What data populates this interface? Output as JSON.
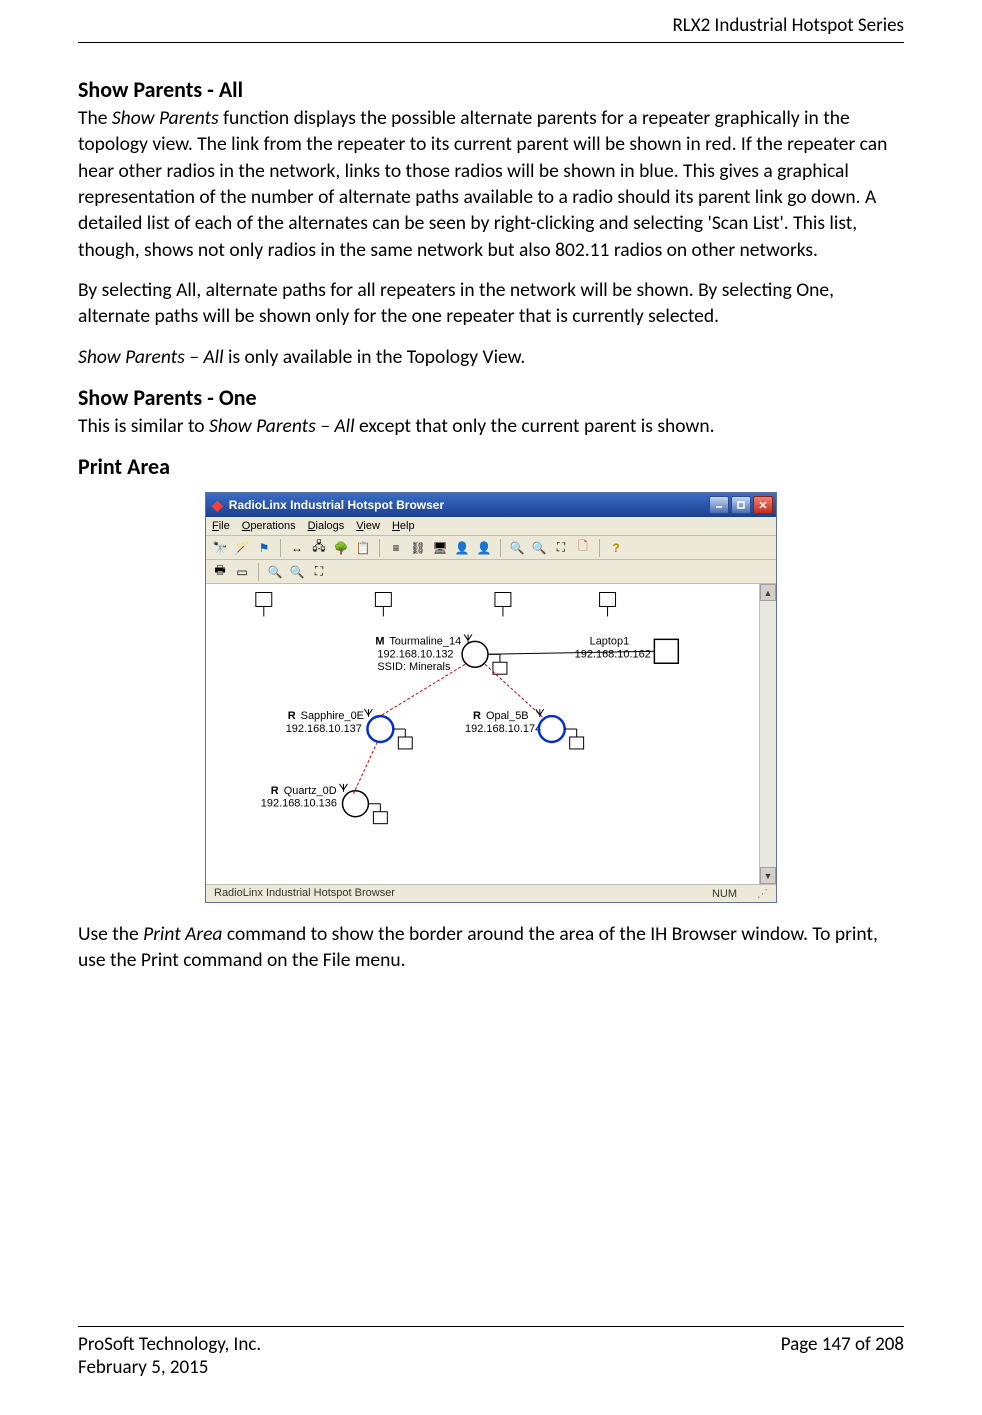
{
  "header": {
    "product": "RLX2 Industrial Hotspot Series"
  },
  "sections": {
    "showParentsAll": {
      "title": "Show Parents - All",
      "p1_a": "The ",
      "p1_b": "Show Parents",
      "p1_c": " function displays the possible alternate parents for a repeater graphically in the topology view. The link from the repeater to its current parent will be shown in red. If the repeater can hear other radios in the network, links to those radios will be shown in blue. This gives a graphical representation of the number of alternate paths available to a radio should its parent link go down. A detailed list of each of the alternates can be seen by right-clicking and selecting 'Scan List'. This list, though, shows not only radios in the same network but also 802.11 radios on other networks.",
      "p2": "By selecting All, alternate paths for all repeaters in the network will be shown. By selecting One, alternate paths will be shown only for the one repeater that is currently selected.",
      "p3_a": "Show Parents – All",
      "p3_b": " is only available in the Topology View."
    },
    "showParentsOne": {
      "title": "Show Parents - One",
      "p1_a": "This is similar to ",
      "p1_b": "Show Parents – All",
      "p1_c": " except that only the current parent is shown."
    },
    "printArea": {
      "title": "Print Area",
      "p1_a": "Use the ",
      "p1_b": "Print Area",
      "p1_c": " command to show the border around the area of the IH Browser window. To print, use the Print command on the File menu."
    }
  },
  "app": {
    "title": "RadioLinx Industrial Hotspot Browser",
    "menus": [
      "File",
      "Operations",
      "Dialogs",
      "View",
      "Help"
    ],
    "status_left": "RadioLinx Industrial Hotspot Browser",
    "status_num": "NUM",
    "nodes": {
      "master": {
        "role": "M",
        "name": "Tourmaline_14",
        "ip": "192.168.10.132",
        "ssid": "SSID: Minerals"
      },
      "laptop": {
        "name": "Laptop1",
        "ip": "192.168.10.162"
      },
      "sapphire": {
        "role": "R",
        "name": "Sapphire_0E",
        "ip": "192.168.10.137"
      },
      "opal": {
        "role": "R",
        "name": "Opal_5B",
        "ip": "192.168.10.174"
      },
      "quartz": {
        "role": "R",
        "name": "Quartz_0D",
        "ip": "192.168.10.136"
      }
    }
  },
  "footer": {
    "company": "ProSoft Technology, Inc.",
    "date": "February 5, 2015",
    "page": "Page 147 of 208"
  }
}
